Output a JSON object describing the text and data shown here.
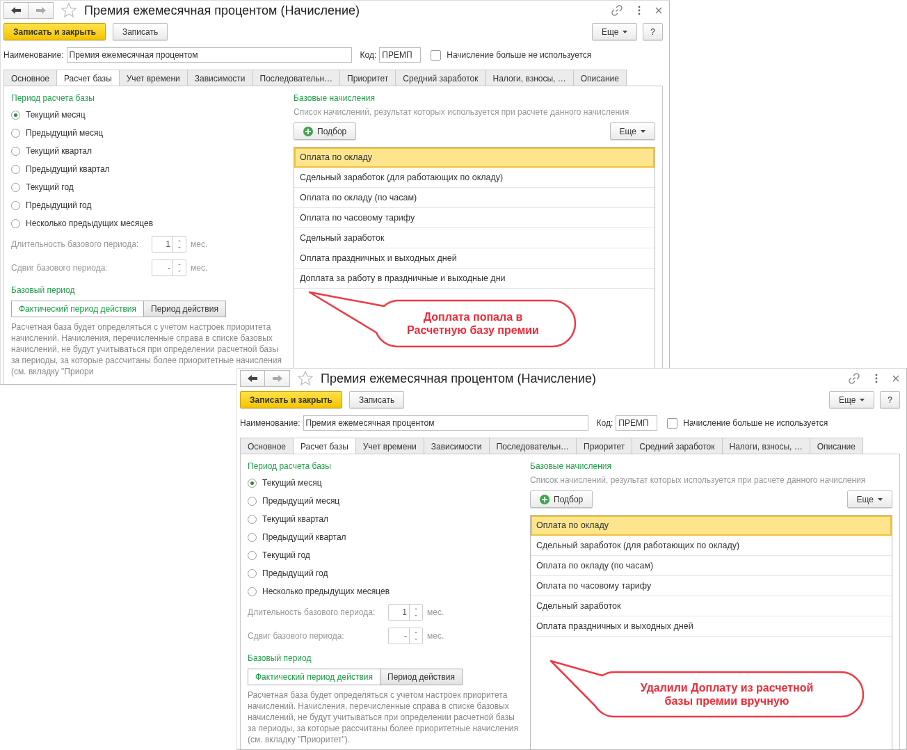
{
  "windows": [
    {
      "title": "Премия ежемесячная процентом (Начисление)",
      "save_close_button": "Записать и закрыть",
      "save_button": "Записать",
      "more_button": "Еще",
      "help_button": "?",
      "name_label": "Наименование:",
      "name_value": "Премия ежемесячная процентом",
      "code_label": "Код:",
      "code_value": "ПРЕМП",
      "unused_checkbox": {
        "label": "Начисление больше не используется",
        "checked": false
      },
      "tabs": [
        {
          "label": "Основное",
          "selected": false
        },
        {
          "label": "Расчет базы",
          "selected": true
        },
        {
          "label": "Учет времени",
          "selected": false
        },
        {
          "label": "Зависимости",
          "selected": false
        },
        {
          "label": "Последовательн…",
          "selected": false
        },
        {
          "label": "Приоритет",
          "selected": false
        },
        {
          "label": "Средний заработок",
          "selected": false
        },
        {
          "label": "Налоги, взносы, …",
          "selected": false
        },
        {
          "label": "Описание",
          "selected": false
        }
      ],
      "period_title": "Период расчета базы",
      "period_options": [
        {
          "label": "Текущий месяц",
          "selected": true
        },
        {
          "label": "Предыдущий месяц",
          "selected": false
        },
        {
          "label": "Текущий квартал",
          "selected": false
        },
        {
          "label": "Предыдущий квартал",
          "selected": false
        },
        {
          "label": "Текущий год",
          "selected": false
        },
        {
          "label": "Предыдущий год",
          "selected": false
        },
        {
          "label": "Несколько предыдущих месяцев",
          "selected": false
        }
      ],
      "spin_fields": [
        {
          "label": "Длительность базового периода:",
          "value": "1",
          "unit": "мес."
        },
        {
          "label": "Сдвиг базового периода:",
          "value": "-",
          "unit": "мес."
        }
      ],
      "base_period_title": "Базовый период",
      "base_period_options": [
        {
          "label": "Фактический период действия",
          "selected": true
        },
        {
          "label": "Период действия",
          "selected": false
        }
      ],
      "description": "Расчетная база будет определяться с учетом настроек приоритета начислений. Начисления, перечисленные справа в списке базовых начислений, не будут учитываться при определении расчетной базы за периоды, за которые рассчитаны более приоритетные начисления (см. вкладку \"Приори",
      "base_title": "Базовые начисления",
      "base_subtitle": "Список начислений, результат которых используется при расчете данного начисления",
      "pick_button": "Подбор",
      "list_more_button": "Еще",
      "rows": [
        {
          "label": "Оплата по окладу",
          "selected": true
        },
        {
          "label": "Сдельный заработок (для работающих по окладу)",
          "selected": false
        },
        {
          "label": "Оплата по окладу (по часам)",
          "selected": false
        },
        {
          "label": "Оплата по часовому тарифу",
          "selected": false
        },
        {
          "label": "Сдельный заработок",
          "selected": false
        },
        {
          "label": "Оплата праздничных и выходных дней",
          "selected": false
        },
        {
          "label": "Доплата за работу в праздничные и выходные дни",
          "selected": false
        }
      ],
      "callout": "Доплата попала в\nРасчетную базу премии"
    },
    {
      "title": "Премия ежемесячная процентом (Начисление)",
      "save_close_button": "Записать и закрыть",
      "save_button": "Записать",
      "more_button": "Еще",
      "help_button": "?",
      "name_label": "Наименование:",
      "name_value": "Премия ежемесячная процентом",
      "code_label": "Код:",
      "code_value": "ПРЕМП",
      "unused_checkbox": {
        "label": "Начисление больше не используется",
        "checked": false
      },
      "tabs": [
        {
          "label": "Основное",
          "selected": false
        },
        {
          "label": "Расчет базы",
          "selected": true
        },
        {
          "label": "Учет времени",
          "selected": false
        },
        {
          "label": "Зависимости",
          "selected": false
        },
        {
          "label": "Последовательн…",
          "selected": false
        },
        {
          "label": "Приоритет",
          "selected": false
        },
        {
          "label": "Средний заработок",
          "selected": false
        },
        {
          "label": "Налоги, взносы, …",
          "selected": false
        },
        {
          "label": "Описание",
          "selected": false
        }
      ],
      "period_title": "Период расчета базы",
      "period_options": [
        {
          "label": "Текущий месяц",
          "selected": true
        },
        {
          "label": "Предыдущий месяц",
          "selected": false
        },
        {
          "label": "Текущий квартал",
          "selected": false
        },
        {
          "label": "Предыдущий квартал",
          "selected": false
        },
        {
          "label": "Текущий год",
          "selected": false
        },
        {
          "label": "Предыдущий год",
          "selected": false
        },
        {
          "label": "Несколько предыдущих месяцев",
          "selected": false
        }
      ],
      "spin_fields": [
        {
          "label": "Длительность базового периода:",
          "value": "1",
          "unit": "мес."
        },
        {
          "label": "Сдвиг базового периода:",
          "value": "-",
          "unit": "мес."
        }
      ],
      "base_period_title": "Базовый период",
      "base_period_options": [
        {
          "label": "Фактический период действия",
          "selected": true
        },
        {
          "label": "Период действия",
          "selected": false
        }
      ],
      "description": "Расчетная база будет определяться с учетом настроек приоритета начислений. Начисления, перечисленные справа в списке базовых начислений, не будут учитываться при определении расчетной базы за периоды, за которые рассчитаны более приоритетные начисления (см. вкладку \"Приоритет\").",
      "base_title": "Базовые начисления",
      "base_subtitle": "Список начислений, результат которых используется при расчете данного начисления",
      "pick_button": "Подбор",
      "list_more_button": "Еще",
      "rows": [
        {
          "label": "Оплата по окладу",
          "selected": true
        },
        {
          "label": "Сдельный заработок (для работающих по окладу)",
          "selected": false
        },
        {
          "label": "Оплата по окладу (по часам)",
          "selected": false
        },
        {
          "label": "Оплата по часовому тарифу",
          "selected": false
        },
        {
          "label": "Сдельный заработок",
          "selected": false
        },
        {
          "label": "Оплата праздничных и выходных дней",
          "selected": false
        }
      ],
      "callout": "Удалили Доплату из расчетной\nбазы премии вручную"
    }
  ]
}
